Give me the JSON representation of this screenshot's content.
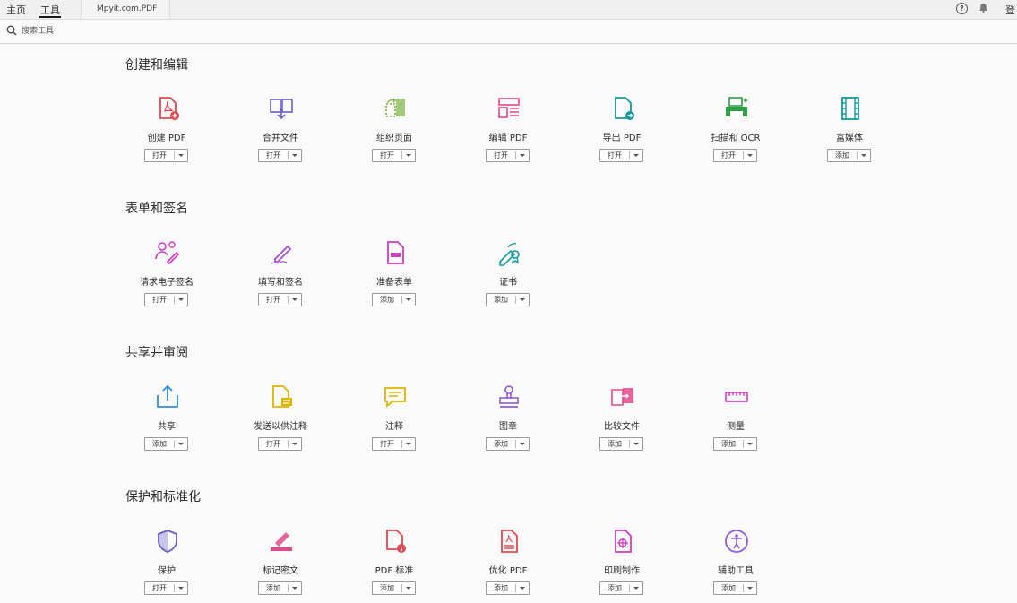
{
  "tabs": {
    "home": "主页",
    "tools": "工具",
    "document": "Mpyit.com.PDF"
  },
  "header": {
    "help_glyph": "?",
    "login_partial": "登"
  },
  "search": {
    "placeholder": "搜索工具"
  },
  "sections": [
    {
      "title": "创建和编辑",
      "tools": [
        {
          "name": "创建 PDF",
          "button": "打开",
          "icon": "create-pdf-icon",
          "color": "#e34850"
        },
        {
          "name": "合并文件",
          "button": "打开",
          "icon": "combine-files-icon",
          "color": "#6a5ec9"
        },
        {
          "name": "组织页面",
          "button": "打开",
          "icon": "organize-pages-icon",
          "color": "#7cb342"
        },
        {
          "name": "编辑 PDF",
          "button": "打开",
          "icon": "edit-pdf-icon",
          "color": "#e5498b"
        },
        {
          "name": "导出 PDF",
          "button": "打开",
          "icon": "export-pdf-icon",
          "color": "#159a9c"
        },
        {
          "name": "扫描和 OCR",
          "button": "打开",
          "icon": "scan-ocr-icon",
          "color": "#2ea043"
        },
        {
          "name": "富媒体",
          "button": "添加",
          "icon": "rich-media-icon",
          "color": "#159a9c"
        }
      ]
    },
    {
      "title": "表单和签名",
      "tools": [
        {
          "name": "请求电子签名",
          "button": "打开",
          "icon": "request-esign-icon",
          "color": "#d23bbd"
        },
        {
          "name": "填写和签名",
          "button": "打开",
          "icon": "fill-sign-icon",
          "color": "#a24fd6"
        },
        {
          "name": "准备表单",
          "button": "添加",
          "icon": "prepare-form-icon",
          "color": "#d23bbd"
        },
        {
          "name": "证书",
          "button": "添加",
          "icon": "certificates-icon",
          "color": "#159a9c"
        }
      ]
    },
    {
      "title": "共享并审阅",
      "tools": [
        {
          "name": "共享",
          "button": "添加",
          "icon": "share-icon",
          "color": "#2d8ee0"
        },
        {
          "name": "发送以供注释",
          "button": "打开",
          "icon": "send-for-comments-icon",
          "color": "#e0b300"
        },
        {
          "name": "注释",
          "button": "打开",
          "icon": "comment-icon",
          "color": "#e0b300"
        },
        {
          "name": "图章",
          "button": "添加",
          "icon": "stamp-icon",
          "color": "#8d5cd6"
        },
        {
          "name": "比较文件",
          "button": "添加",
          "icon": "compare-files-icon",
          "color": "#e5498b"
        },
        {
          "name": "测量",
          "button": "添加",
          "icon": "measure-icon",
          "color": "#d23bbd"
        }
      ]
    },
    {
      "title": "保护和标准化",
      "tools": [
        {
          "name": "保护",
          "button": "打开",
          "icon": "protect-icon",
          "color": "#6a5ec9"
        },
        {
          "name": "标记密文",
          "button": "添加",
          "icon": "redact-icon",
          "color": "#e5498b"
        },
        {
          "name": "PDF 标准",
          "button": "添加",
          "icon": "pdf-standards-icon",
          "color": "#e34850"
        },
        {
          "name": "优化 PDF",
          "button": "添加",
          "icon": "optimize-pdf-icon",
          "color": "#e34850"
        },
        {
          "name": "印刷制作",
          "button": "添加",
          "icon": "print-production-icon",
          "color": "#d23bbd"
        },
        {
          "name": "辅助工具",
          "button": "添加",
          "icon": "accessibility-icon",
          "color": "#8d5cd6"
        }
      ]
    }
  ]
}
